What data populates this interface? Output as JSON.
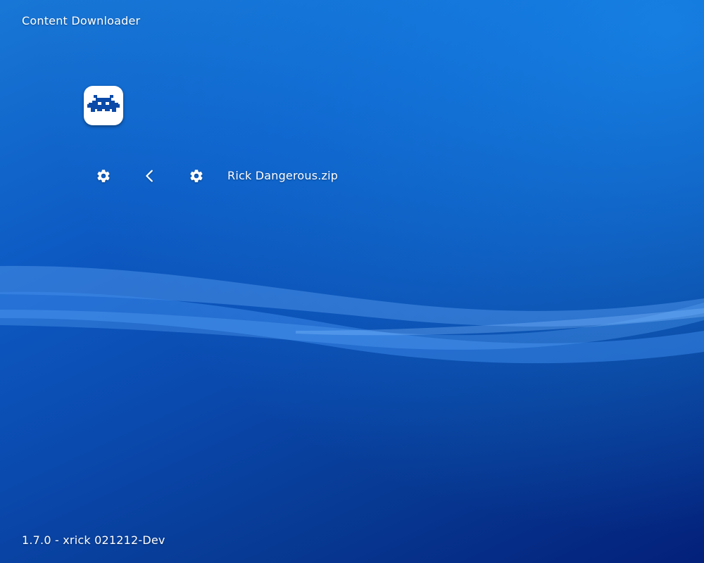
{
  "header": {
    "title": "Content Downloader"
  },
  "logo": {
    "icon": "retroarch-invader-icon",
    "color": "#0b4aa8"
  },
  "nav": {
    "settings_icon": "gear-icon",
    "back_icon": "chevron-left-icon",
    "item_icon": "gear-icon",
    "item_label": "Rick Dangerous.zip"
  },
  "footer": {
    "version": "1.7.0 - xrick 021212-Dev"
  },
  "theme": {
    "background_top": "#1877d6",
    "background_bottom": "#03207a",
    "wave_light": "#3d8ff0",
    "text": "#ffffff"
  }
}
